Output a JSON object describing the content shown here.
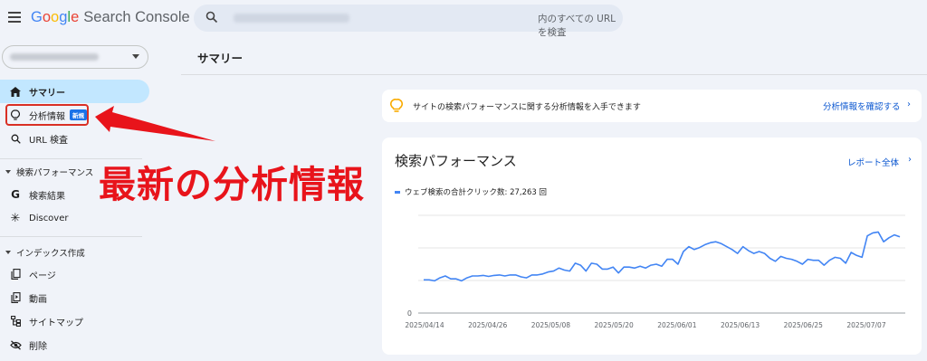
{
  "header": {
    "logo_letters": [
      "G",
      "o",
      "o",
      "g",
      "l",
      "e"
    ],
    "logo_product": "Search Console",
    "search_placeholder": "内のすべての URL を検査"
  },
  "sidebar": {
    "items": [
      {
        "label": "サマリー",
        "icon": "home-icon",
        "active": true
      },
      {
        "label": "分析情報",
        "icon": "lightbulb-icon",
        "badge": "新規"
      },
      {
        "label": "URL 検査",
        "icon": "search-icon"
      }
    ],
    "sections": [
      {
        "label": "検索パフォーマンス",
        "items": [
          {
            "label": "検索結果",
            "icon": "google-g-icon"
          },
          {
            "label": "Discover",
            "icon": "asterisk-icon"
          }
        ]
      },
      {
        "label": "インデックス作成",
        "items": [
          {
            "label": "ページ",
            "icon": "pages-icon"
          },
          {
            "label": "動画",
            "icon": "video-icon"
          },
          {
            "label": "サイトマップ",
            "icon": "sitemap-icon"
          },
          {
            "label": "削除",
            "icon": "eye-off-icon"
          }
        ]
      }
    ]
  },
  "main": {
    "page_title": "サマリー",
    "insight_banner": {
      "text": "サイトの検索パフォーマンスに関する分析情報を入手できます",
      "link": "分析情報を確認する"
    },
    "performance": {
      "title": "検索パフォーマンス",
      "report_link": "レポート全体",
      "legend": "ウェブ検索の合計クリック数: 27,263 回"
    }
  },
  "annotation": {
    "text": "最新の分析情報",
    "color": "#e8141b"
  },
  "colors": {
    "accent": "#0b57d0",
    "active_nav": "#c2e7ff",
    "series": "#4285f4",
    "annotation": "#e8141b"
  },
  "chart_data": {
    "type": "line",
    "series": [
      {
        "name": "ウェブ検索の合計クリック数: 27,263 回",
        "values": [
          0.68,
          0.68,
          0.66,
          0.72,
          0.76,
          0.7,
          0.7,
          0.66,
          0.72,
          0.76,
          0.76,
          0.77,
          0.75,
          0.77,
          0.78,
          0.76,
          0.78,
          0.78,
          0.74,
          0.72,
          0.78,
          0.78,
          0.8,
          0.84,
          0.86,
          0.92,
          0.88,
          0.86,
          1.02,
          0.98,
          0.86,
          1.02,
          1.0,
          0.9,
          0.9,
          0.94,
          0.82,
          0.94,
          0.94,
          0.92,
          0.96,
          0.92,
          0.98,
          1.0,
          0.96,
          1.1,
          1.1,
          1.0,
          1.26,
          1.36,
          1.3,
          1.34,
          1.4,
          1.44,
          1.46,
          1.42,
          1.36,
          1.3,
          1.22,
          1.36,
          1.28,
          1.22,
          1.26,
          1.22,
          1.12,
          1.06,
          1.16,
          1.12,
          1.1,
          1.06,
          1.0,
          1.1,
          1.08,
          1.08,
          0.98,
          1.08,
          1.14,
          1.12,
          1.02,
          1.24,
          1.18,
          1.14,
          1.58,
          1.64,
          1.66,
          1.46,
          1.54,
          1.6,
          1.56
        ]
      }
    ],
    "x_tick_labels": [
      "2025/04/14",
      "2025/04/26",
      "2025/05/08",
      "2025/05/20",
      "2025/06/01",
      "2025/06/13",
      "2025/06/25",
      "2025/07/07"
    ],
    "y_tick_labels": [
      "0"
    ],
    "ylim": [
      0,
      2.0
    ],
    "grid": true
  }
}
